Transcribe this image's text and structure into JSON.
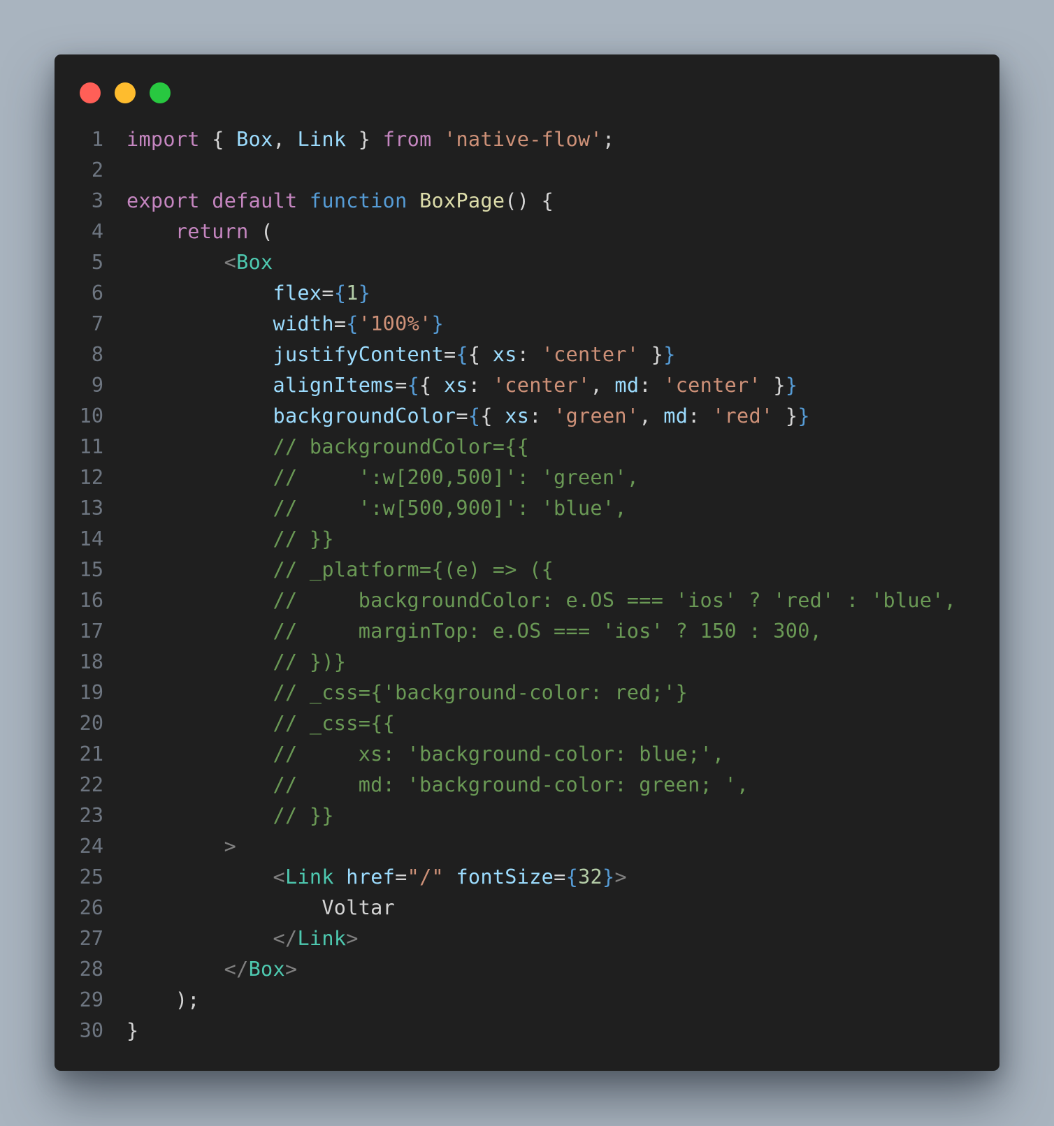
{
  "window": {
    "traffic_lights": [
      {
        "name": "close",
        "color": "#ff5f57"
      },
      {
        "name": "minimize",
        "color": "#febc2e"
      },
      {
        "name": "maximize",
        "color": "#28c840"
      }
    ]
  },
  "editor": {
    "language": "jsx",
    "lines": [
      {
        "n": "1",
        "tokens": [
          [
            "kw",
            "import"
          ],
          [
            "pn",
            " { "
          ],
          [
            "var",
            "Box"
          ],
          [
            "pn",
            ", "
          ],
          [
            "var",
            "Link"
          ],
          [
            "pn",
            " } "
          ],
          [
            "kw",
            "from"
          ],
          [
            "pn",
            " "
          ],
          [
            "str",
            "'native-flow'"
          ],
          [
            "pn",
            ";"
          ]
        ]
      },
      {
        "n": "2",
        "tokens": []
      },
      {
        "n": "3",
        "tokens": [
          [
            "kw",
            "export"
          ],
          [
            "pn",
            " "
          ],
          [
            "kw",
            "default"
          ],
          [
            "pn",
            " "
          ],
          [
            "st",
            "function"
          ],
          [
            "pn",
            " "
          ],
          [
            "fn",
            "BoxPage"
          ],
          [
            "pn",
            "() {"
          ]
        ]
      },
      {
        "n": "4",
        "tokens": [
          [
            "pn",
            "    "
          ],
          [
            "kw",
            "return"
          ],
          [
            "pn",
            " ("
          ]
        ]
      },
      {
        "n": "5",
        "tokens": [
          [
            "pn",
            "        "
          ],
          [
            "br",
            "<"
          ],
          [
            "tag",
            "Box"
          ]
        ]
      },
      {
        "n": "6",
        "tokens": [
          [
            "pn",
            "            "
          ],
          [
            "var",
            "flex"
          ],
          [
            "pn",
            "="
          ],
          [
            "jsx",
            "{"
          ],
          [
            "num",
            "1"
          ],
          [
            "jsx",
            "}"
          ]
        ]
      },
      {
        "n": "7",
        "tokens": [
          [
            "pn",
            "            "
          ],
          [
            "var",
            "width"
          ],
          [
            "pn",
            "="
          ],
          [
            "jsx",
            "{"
          ],
          [
            "str",
            "'100%'"
          ],
          [
            "jsx",
            "}"
          ]
        ]
      },
      {
        "n": "8",
        "tokens": [
          [
            "pn",
            "            "
          ],
          [
            "var",
            "justifyContent"
          ],
          [
            "pn",
            "="
          ],
          [
            "jsx",
            "{"
          ],
          [
            "pn",
            "{ "
          ],
          [
            "var",
            "xs"
          ],
          [
            "pn",
            ": "
          ],
          [
            "str",
            "'center'"
          ],
          [
            "pn",
            " }"
          ],
          [
            "jsx",
            "}"
          ]
        ]
      },
      {
        "n": "9",
        "tokens": [
          [
            "pn",
            "            "
          ],
          [
            "var",
            "alignItems"
          ],
          [
            "pn",
            "="
          ],
          [
            "jsx",
            "{"
          ],
          [
            "pn",
            "{ "
          ],
          [
            "var",
            "xs"
          ],
          [
            "pn",
            ": "
          ],
          [
            "str",
            "'center'"
          ],
          [
            "pn",
            ", "
          ],
          [
            "var",
            "md"
          ],
          [
            "pn",
            ": "
          ],
          [
            "str",
            "'center'"
          ],
          [
            "pn",
            " }"
          ],
          [
            "jsx",
            "}"
          ]
        ]
      },
      {
        "n": "10",
        "tokens": [
          [
            "pn",
            "            "
          ],
          [
            "var",
            "backgroundColor"
          ],
          [
            "pn",
            "="
          ],
          [
            "jsx",
            "{"
          ],
          [
            "pn",
            "{ "
          ],
          [
            "var",
            "xs"
          ],
          [
            "pn",
            ": "
          ],
          [
            "str",
            "'green'"
          ],
          [
            "pn",
            ", "
          ],
          [
            "var",
            "md"
          ],
          [
            "pn",
            ": "
          ],
          [
            "str",
            "'red'"
          ],
          [
            "pn",
            " }"
          ],
          [
            "jsx",
            "}"
          ]
        ]
      },
      {
        "n": "11",
        "tokens": [
          [
            "pn",
            "            "
          ],
          [
            "cm",
            "// backgroundColor={{"
          ]
        ]
      },
      {
        "n": "12",
        "tokens": [
          [
            "pn",
            "            "
          ],
          [
            "cm",
            "//     ':w[200,500]': 'green',"
          ]
        ]
      },
      {
        "n": "13",
        "tokens": [
          [
            "pn",
            "            "
          ],
          [
            "cm",
            "//     ':w[500,900]': 'blue',"
          ]
        ]
      },
      {
        "n": "14",
        "tokens": [
          [
            "pn",
            "            "
          ],
          [
            "cm",
            "// }}"
          ]
        ]
      },
      {
        "n": "15",
        "tokens": [
          [
            "pn",
            "            "
          ],
          [
            "cm",
            "// _platform={(e) => ({"
          ]
        ]
      },
      {
        "n": "16",
        "tokens": [
          [
            "pn",
            "            "
          ],
          [
            "cm",
            "//     backgroundColor: e.OS === 'ios' ? 'red' : 'blue',"
          ]
        ]
      },
      {
        "n": "17",
        "tokens": [
          [
            "pn",
            "            "
          ],
          [
            "cm",
            "//     marginTop: e.OS === 'ios' ? 150 : 300,"
          ]
        ]
      },
      {
        "n": "18",
        "tokens": [
          [
            "pn",
            "            "
          ],
          [
            "cm",
            "// })}"
          ]
        ]
      },
      {
        "n": "19",
        "tokens": [
          [
            "pn",
            "            "
          ],
          [
            "cm",
            "// _css={'background-color: red;'}"
          ]
        ]
      },
      {
        "n": "20",
        "tokens": [
          [
            "pn",
            "            "
          ],
          [
            "cm",
            "// _css={{"
          ]
        ]
      },
      {
        "n": "21",
        "tokens": [
          [
            "pn",
            "            "
          ],
          [
            "cm",
            "//     xs: 'background-color: blue;',"
          ]
        ]
      },
      {
        "n": "22",
        "tokens": [
          [
            "pn",
            "            "
          ],
          [
            "cm",
            "//     md: 'background-color: green; ',"
          ]
        ]
      },
      {
        "n": "23",
        "tokens": [
          [
            "pn",
            "            "
          ],
          [
            "cm",
            "// }}"
          ]
        ]
      },
      {
        "n": "24",
        "tokens": [
          [
            "pn",
            "        "
          ],
          [
            "br",
            ">"
          ]
        ]
      },
      {
        "n": "25",
        "tokens": [
          [
            "pn",
            "            "
          ],
          [
            "br",
            "<"
          ],
          [
            "tag",
            "Link"
          ],
          [
            "pn",
            " "
          ],
          [
            "var",
            "href"
          ],
          [
            "pn",
            "="
          ],
          [
            "str",
            "\"/\""
          ],
          [
            "pn",
            " "
          ],
          [
            "var",
            "fontSize"
          ],
          [
            "pn",
            "="
          ],
          [
            "jsx",
            "{"
          ],
          [
            "num",
            "32"
          ],
          [
            "jsx",
            "}"
          ],
          [
            "br",
            ">"
          ]
        ]
      },
      {
        "n": "26",
        "tokens": [
          [
            "pn",
            "                Voltar"
          ]
        ]
      },
      {
        "n": "27",
        "tokens": [
          [
            "pn",
            "            "
          ],
          [
            "br",
            "</"
          ],
          [
            "tag",
            "Link"
          ],
          [
            "br",
            ">"
          ]
        ]
      },
      {
        "n": "28",
        "tokens": [
          [
            "pn",
            "        "
          ],
          [
            "br",
            "</"
          ],
          [
            "tag",
            "Box"
          ],
          [
            "br",
            ">"
          ]
        ]
      },
      {
        "n": "29",
        "tokens": [
          [
            "pn",
            "    );"
          ]
        ]
      },
      {
        "n": "30",
        "tokens": [
          [
            "pn",
            "}"
          ]
        ]
      }
    ]
  }
}
